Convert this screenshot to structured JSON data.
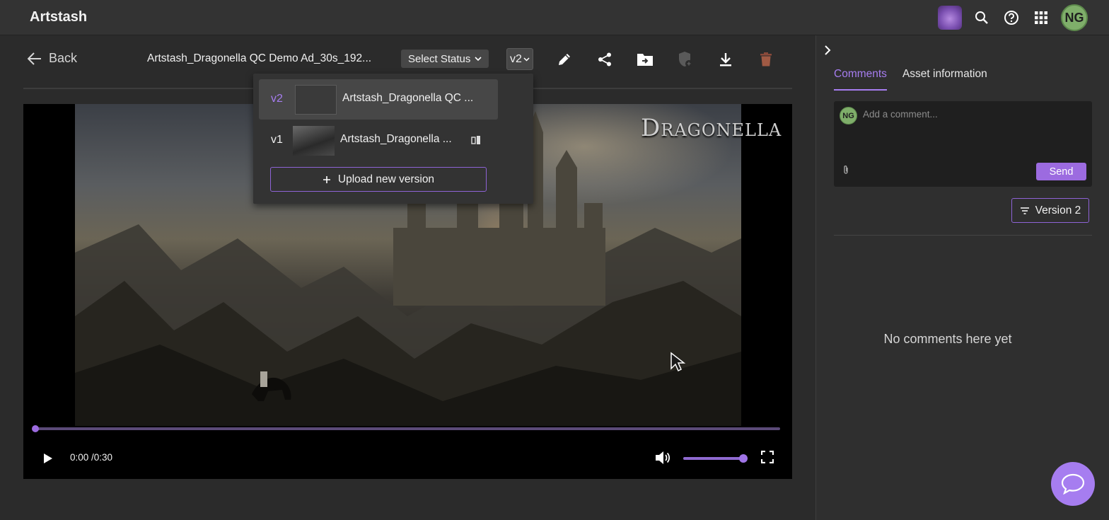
{
  "app": {
    "name": "Artstash"
  },
  "topbar": {
    "avatar_initials": "NG",
    "icons": [
      "workspace-logo",
      "search-icon",
      "help-icon",
      "apps-grid-icon"
    ]
  },
  "toolbar": {
    "back_label": "Back",
    "asset_title": "Artstash_Dragonella QC Demo Ad_30s_192...",
    "status_label": "Select Status",
    "version_label": "v2",
    "tools": [
      "edit-icon",
      "share-icon",
      "move-to-folder-icon",
      "protect-icon",
      "download-icon",
      "delete-icon"
    ]
  },
  "version_dropdown": {
    "items": [
      {
        "version": "v2",
        "name": "Artstash_Dragonella QC ...",
        "selected": true
      },
      {
        "version": "v1",
        "name": "Artstash_Dragonella ...",
        "selected": false
      }
    ],
    "upload_label": "Upload new version"
  },
  "video": {
    "watermark": "Dragonella",
    "time": "0:00 /0:30",
    "progress_fraction": 0.0,
    "volume_fraction": 1.0
  },
  "panel": {
    "tabs": [
      {
        "label": "Comments",
        "active": true
      },
      {
        "label": "Asset information",
        "active": false
      }
    ],
    "comment": {
      "avatar_initials": "NG",
      "placeholder": "Add a comment...",
      "send_label": "Send"
    },
    "filter_label": "Version 2",
    "empty_message": "No comments here yet"
  },
  "colors": {
    "accent": "#a67df0",
    "topbar_bg": "#333333",
    "main_bg": "#2b2b2b",
    "avatar_bg": "#7fae6a"
  }
}
